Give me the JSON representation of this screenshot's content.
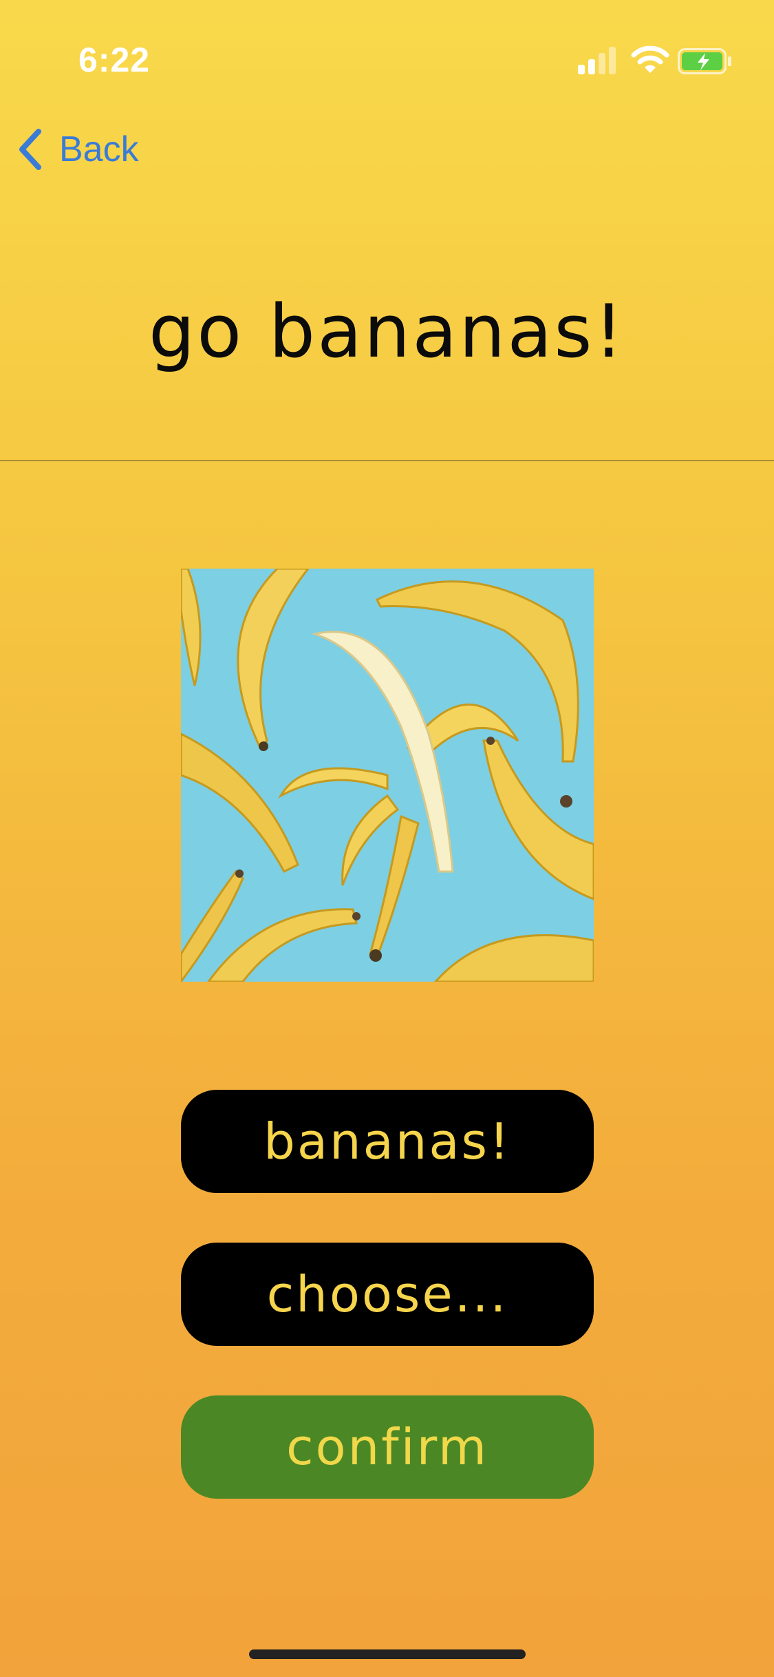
{
  "status_bar": {
    "time": "6:22",
    "signal_icon": "cellular-signal-icon",
    "wifi_icon": "wifi-icon",
    "battery_icon": "battery-charging-icon"
  },
  "nav": {
    "back_label": "Back",
    "back_icon": "chevron-left-icon"
  },
  "header": {
    "title": "go bananas!"
  },
  "image": {
    "subject": "banana-photo"
  },
  "buttons": {
    "bananas_label": "bananas!",
    "choose_label": "choose...",
    "confirm_label": "confirm"
  },
  "colors": {
    "background_top": "#f9d94b",
    "background_bottom": "#f2a33b",
    "back_link": "#3a7bd8",
    "button_dark": "#000000",
    "button_confirm": "#4b8825",
    "button_text": "#f6d54c",
    "photo_background": "#7dcfe3"
  }
}
